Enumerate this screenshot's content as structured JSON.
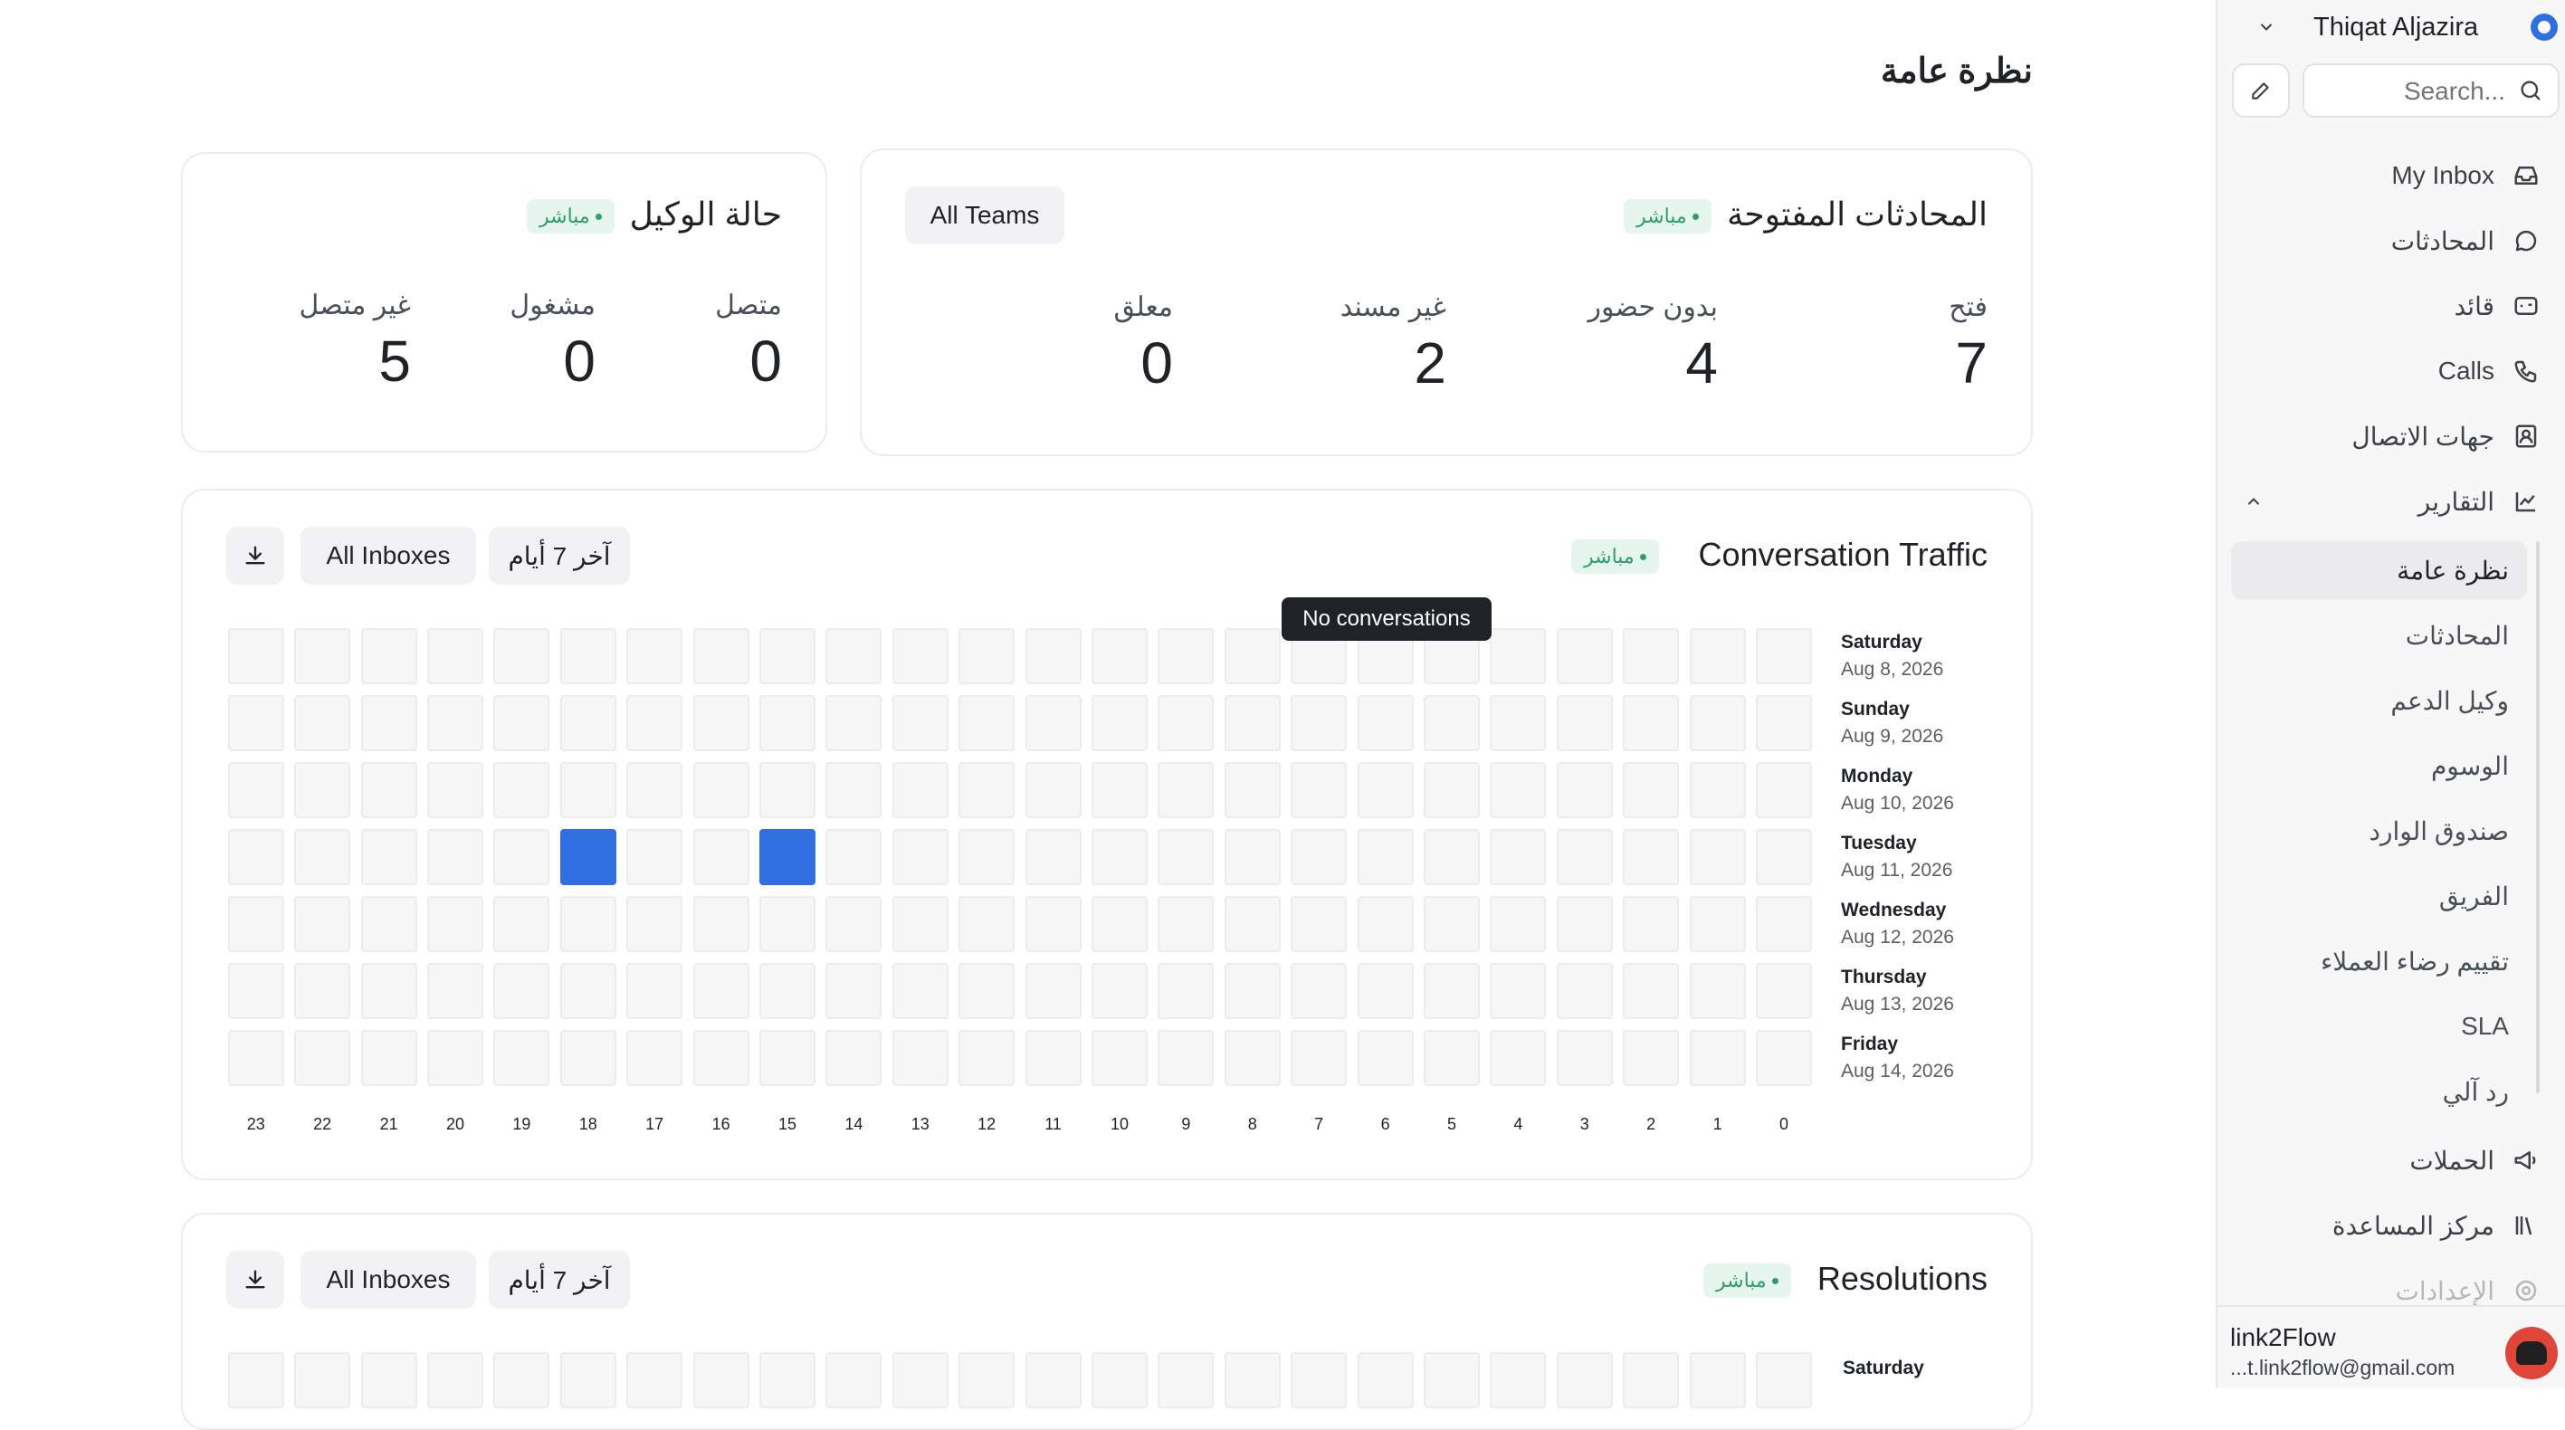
{
  "page_title": "نظرة عامة",
  "sidebar": {
    "account_name": "Thiqat Aljazira",
    "search_placeholder": "Search...",
    "nav": [
      {
        "label": "My Inbox",
        "icon": "inbox-icon"
      },
      {
        "label": "المحادثات",
        "icon": "chat-bubble-icon"
      },
      {
        "label": "قائد",
        "icon": "captain-icon"
      },
      {
        "label": "Calls",
        "icon": "phone-icon"
      },
      {
        "label": "جهات الاتصال",
        "icon": "contact-card-icon"
      },
      {
        "label": "التقارير",
        "icon": "chart-line-icon"
      }
    ],
    "reports_sub": [
      "نظرة عامة",
      "المحادثات",
      "وكيل الدعم",
      "الوسوم",
      "صندوق الوارد",
      "الفريق",
      "تقييم رضاء العملاء",
      "SLA",
      "رد آلي"
    ],
    "nav_bottom": [
      {
        "label": "الحملات",
        "icon": "megaphone-icon"
      },
      {
        "label": "مركز المساعدة",
        "icon": "library-icon"
      },
      {
        "label": "الإعدادات",
        "icon": "settings-icon"
      }
    ],
    "user": {
      "name": "link2Flow",
      "email": "t.link2flow@gmail.com..."
    }
  },
  "open_conversations": {
    "title": "المحادثات المفتوحة",
    "badge": "مباشر",
    "filter": "All Teams",
    "stats": [
      {
        "label": "فتح",
        "value": "7"
      },
      {
        "label": "بدون حضور",
        "value": "4"
      },
      {
        "label": "غير مسند",
        "value": "2"
      },
      {
        "label": "معلق",
        "value": "0"
      }
    ]
  },
  "agent_status": {
    "title": "حالة الوكيل",
    "badge": "مباشر",
    "stats": [
      {
        "label": "متصل",
        "value": "0"
      },
      {
        "label": "مشغول",
        "value": "0"
      },
      {
        "label": "غير متصل",
        "value": "5"
      }
    ]
  },
  "traffic": {
    "title": "Conversation Traffic",
    "badge": "مباشر",
    "range_button": "آخر 7 أيام",
    "inbox_button": "All Inboxes",
    "tooltip": "No conversations",
    "days": [
      {
        "name": "Saturday",
        "date": "Aug 8, 2026"
      },
      {
        "name": "Sunday",
        "date": "Aug 9, 2026"
      },
      {
        "name": "Monday",
        "date": "Aug 10, 2026"
      },
      {
        "name": "Tuesday",
        "date": "Aug 11, 2026"
      },
      {
        "name": "Wednesday",
        "date": "Aug 12, 2026"
      },
      {
        "name": "Thursday",
        "date": "Aug 13, 2026"
      },
      {
        "name": "Friday",
        "date": "Aug 14, 2026"
      }
    ],
    "hours": [
      "0",
      "1",
      "2",
      "3",
      "4",
      "5",
      "6",
      "7",
      "8",
      "9",
      "10",
      "11",
      "12",
      "13",
      "14",
      "15",
      "16",
      "17",
      "18",
      "19",
      "20",
      "21",
      "22",
      "23"
    ],
    "active_cells": [
      {
        "day": "Tuesday",
        "hour": 18
      },
      {
        "day": "Tuesday",
        "hour": 15
      }
    ],
    "active_color": "#2f6fe0"
  },
  "resolutions": {
    "title": "Resolutions",
    "badge": "مباشر",
    "range_button": "آخر 7 أيام",
    "inbox_button": "All Inboxes",
    "first_day": "Saturday"
  }
}
